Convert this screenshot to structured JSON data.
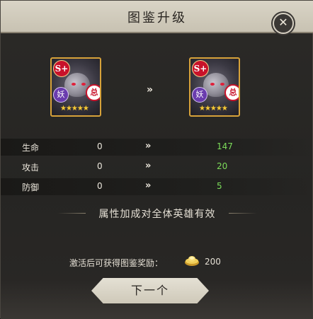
{
  "dialog": {
    "title": "图鉴升级"
  },
  "hero_card": {
    "rank_badge": "S+",
    "faction_badge": "妖",
    "class_badge": "总",
    "stars": "★★★★★"
  },
  "arrow": "»",
  "stats": [
    {
      "label": "生命",
      "old": "0",
      "new": "147"
    },
    {
      "label": "攻击",
      "old": "0",
      "new": "20"
    },
    {
      "label": "防御",
      "old": "0",
      "new": "5"
    }
  ],
  "bonus_note": "属性加成对全体英雄有效",
  "reward": {
    "text": "激活后可获得图鉴奖励：",
    "amount": "200",
    "icon": "gold-ingot-icon"
  },
  "next_button": "下一个",
  "colors": {
    "stat_new": "#7cdc5a",
    "card_border": "#d7a23a"
  }
}
